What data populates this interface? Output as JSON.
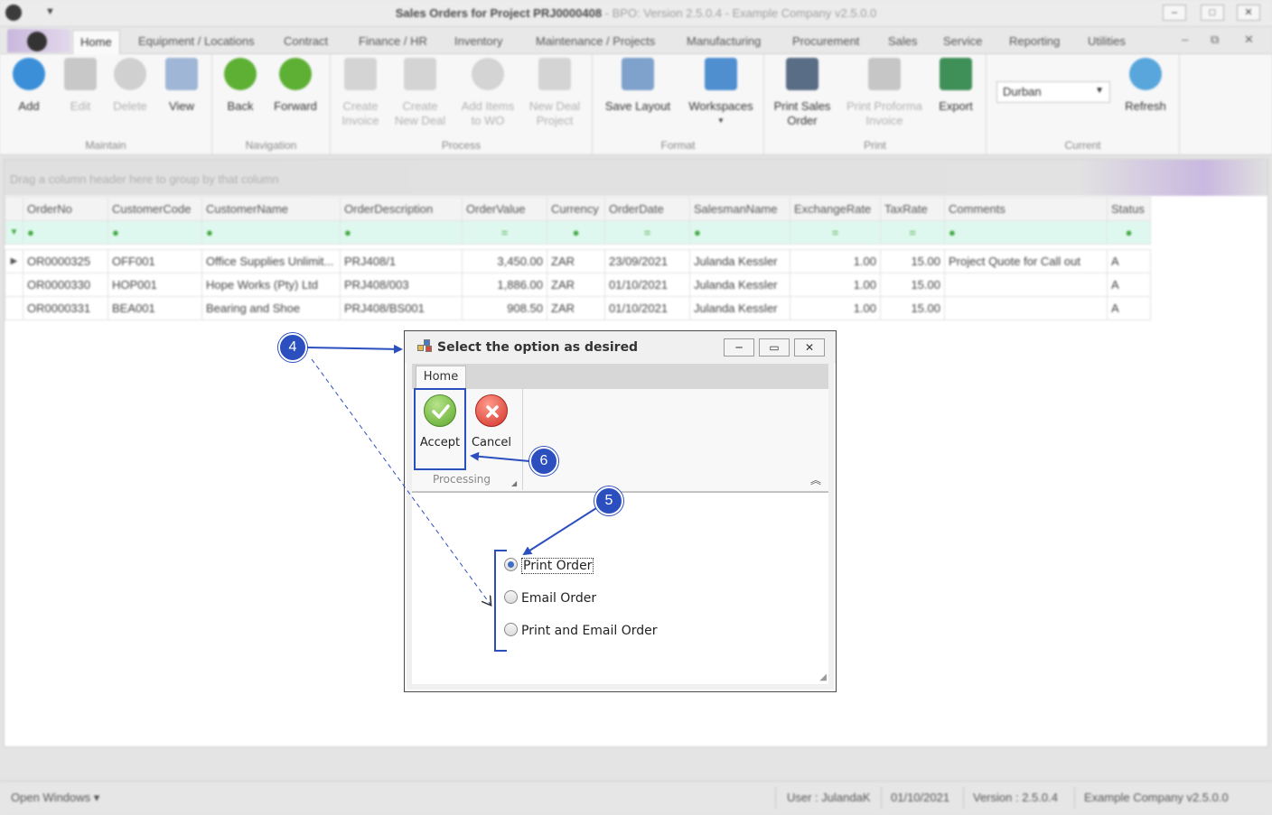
{
  "titlebar": {
    "title": "Sales Orders for Project PRJ0000408",
    "subtitle": " - BPO: Version 2.5.0.4 - Example Company v2.5.0.0",
    "minimize": "–",
    "maximize": "□",
    "close": "✕"
  },
  "menu": {
    "tabs": [
      "Home",
      "Equipment / Locations",
      "Contract",
      "Finance / HR",
      "Inventory",
      "Maintenance / Projects",
      "Manufacturing",
      "Procurement",
      "Sales",
      "Service",
      "Reporting",
      "Utilities"
    ],
    "mdi_min": "–",
    "mdi_restore": "⧉",
    "mdi_close": "✕"
  },
  "ribbon": {
    "groups": {
      "maintain": "Maintain",
      "navigation": "Navigation",
      "process": "Process",
      "format": "Format",
      "print": "Print",
      "current": "Current"
    },
    "buttons": {
      "add": "Add",
      "edit": "Edit",
      "delete": "Delete",
      "view": "View",
      "back": "Back",
      "forward": "Forward",
      "create_invoice": "Create Invoice",
      "create_new_deal": "Create New Deal",
      "add_items_to_wo": "Add Items to WO",
      "new_deal_project": "New Deal Project",
      "save_layout": "Save Layout",
      "workspaces": "Workspaces",
      "print_sales_order": "Print Sales Order",
      "print_proforma_invoice": "Print Proforma Invoice",
      "export": "Export",
      "refresh": "Refresh"
    },
    "current_site": "Durban"
  },
  "grid": {
    "group_hint": "Drag a column header here to group by that column",
    "columns": [
      "OrderNo",
      "CustomerCode",
      "CustomerName",
      "OrderDescription",
      "OrderValue",
      "Currency",
      "OrderDate",
      "SalesmanName",
      "ExchangeRate",
      "TaxRate",
      "Comments",
      "Status"
    ],
    "rows": [
      [
        "OR0000325",
        "OFF001",
        "Office Supplies Unlimit...",
        "PRJ408/1",
        "3,450.00",
        "ZAR",
        "23/09/2021",
        "Julanda Kessler",
        "1.00",
        "15.00",
        "Project Quote for Call out",
        "A"
      ],
      [
        "OR0000330",
        "HOP001",
        "Hope Works (Pty) Ltd",
        "PRJ408/003",
        "1,886.00",
        "ZAR",
        "01/10/2021",
        "Julanda Kessler",
        "1.00",
        "15.00",
        "",
        "A"
      ],
      [
        "OR0000331",
        "BEA001",
        "Bearing and Shoe",
        "PRJ408/BS001",
        "908.50",
        "ZAR",
        "01/10/2021",
        "Julanda Kessler",
        "1.00",
        "15.00",
        "",
        "A"
      ]
    ]
  },
  "statusbar": {
    "open_windows": "Open Windows ▾",
    "user": "User : JulandaK",
    "date": "01/10/2021",
    "version": "Version : 2.5.0.4",
    "company": "Example Company v2.5.0.0"
  },
  "dialog": {
    "title": "Select the option as desired",
    "tab": "Home",
    "accept": "Accept",
    "cancel": "Cancel",
    "group_label": "Processing",
    "options": [
      {
        "label": "Print Order",
        "checked": true
      },
      {
        "label": "Email Order",
        "checked": false
      },
      {
        "label": "Print and Email Order",
        "checked": false
      }
    ]
  },
  "annotations": {
    "step_4": "4",
    "step_5": "5",
    "step_6": "6",
    "color": "#2c4fbf"
  }
}
